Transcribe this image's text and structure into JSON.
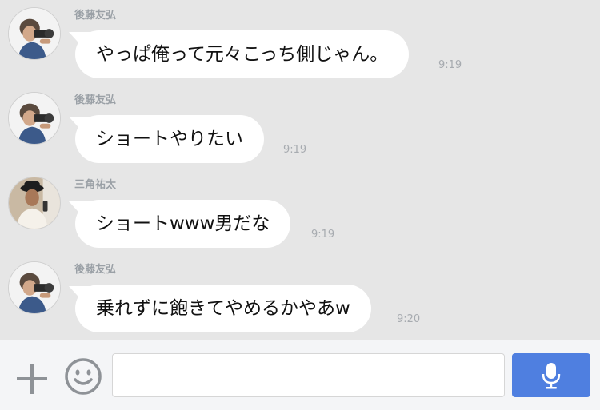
{
  "messages": [
    {
      "sender": "後藤友弘",
      "text": "やっぱ俺って元々こっち側じゃん。",
      "time": "9:19"
    },
    {
      "sender": "後藤友弘",
      "text": "ショートやりたい",
      "time": "9:19"
    },
    {
      "sender": "三角祐太",
      "text": "ショートwww男だな",
      "time": "9:19"
    },
    {
      "sender": "後藤友弘",
      "text": "乗れずに飽きてやめるかやあw",
      "time": "9:20"
    }
  ],
  "input": {
    "value": "",
    "placeholder": ""
  },
  "icons": {
    "add": "plus-icon",
    "emoji": "smiley-icon",
    "voice": "microphone-icon"
  },
  "colors": {
    "chat_background": "#e6e6e6",
    "bubble": "#ffffff",
    "voice_button": "#4f7fe0",
    "icon_gray": "#8e9297"
  }
}
